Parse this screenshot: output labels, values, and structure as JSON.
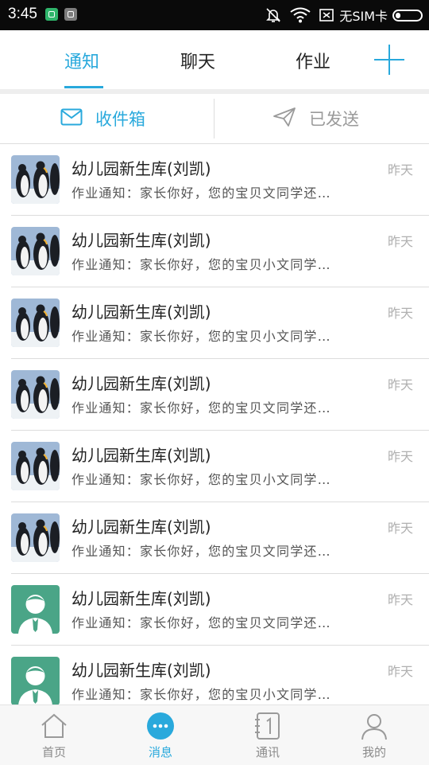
{
  "status_bar": {
    "time": "3:45",
    "carrier": "无SIM卡"
  },
  "tabs": [
    {
      "label": "通知",
      "active": true
    },
    {
      "label": "聊天",
      "active": false
    },
    {
      "label": "作业",
      "active": false
    }
  ],
  "subtabs": {
    "inbox": "收件箱",
    "sent": "已发送"
  },
  "messages": [
    {
      "title": "幼儿园新生库(刘凯)",
      "preview": "作业通知：家长你好，您的宝贝文同学还…",
      "time": "昨天",
      "avatar": "penguin"
    },
    {
      "title": "幼儿园新生库(刘凯)",
      "preview": "作业通知：家长你好，您的宝贝小文同学…",
      "time": "昨天",
      "avatar": "penguin"
    },
    {
      "title": "幼儿园新生库(刘凯)",
      "preview": "作业通知：家长你好，您的宝贝小文同学…",
      "time": "昨天",
      "avatar": "penguin"
    },
    {
      "title": "幼儿园新生库(刘凯)",
      "preview": "作业通知：家长你好，您的宝贝文同学还…",
      "time": "昨天",
      "avatar": "penguin"
    },
    {
      "title": "幼儿园新生库(刘凯)",
      "preview": "作业通知：家长你好，您的宝贝小文同学…",
      "time": "昨天",
      "avatar": "penguin"
    },
    {
      "title": "幼儿园新生库(刘凯)",
      "preview": "作业通知：家长你好，您的宝贝文同学还…",
      "time": "昨天",
      "avatar": "penguin"
    },
    {
      "title": "幼儿园新生库(刘凯)",
      "preview": "作业通知：家长你好，您的宝贝文同学还…",
      "time": "昨天",
      "avatar": "person"
    },
    {
      "title": "幼儿园新生库(刘凯)",
      "preview": "作业通知：家长你好，您的宝贝小文同学…",
      "time": "昨天",
      "avatar": "person"
    }
  ],
  "bottom_nav": [
    {
      "label": "首页",
      "icon": "home-icon",
      "active": false
    },
    {
      "label": "消息",
      "icon": "chat-bubble-icon",
      "active": true
    },
    {
      "label": "通讯",
      "icon": "contacts-book-icon",
      "active": false
    },
    {
      "label": "我的",
      "icon": "user-icon",
      "active": false
    }
  ],
  "colors": {
    "accent": "#29a9dc",
    "status_bar": "#0a0a0a",
    "person_avatar_bg": "#4aa587"
  }
}
